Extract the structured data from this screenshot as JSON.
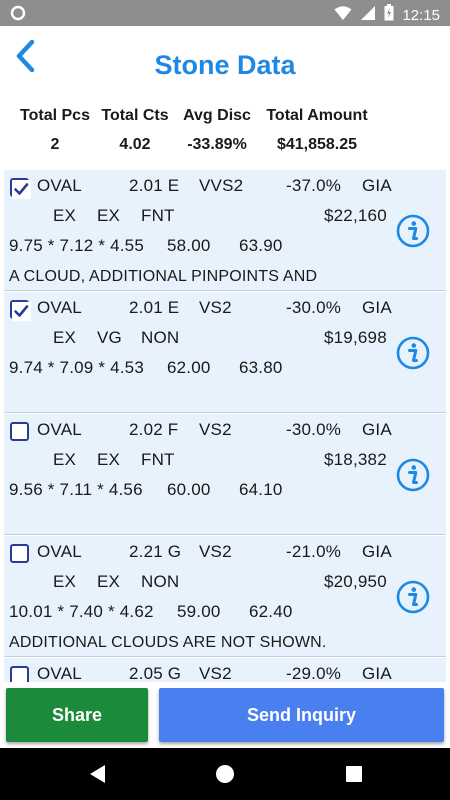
{
  "status": {
    "time": "12:15",
    "icons": [
      "notification-icon",
      "wifi-icon",
      "signal-icon",
      "battery-icon"
    ]
  },
  "header": {
    "title": "Stone Data",
    "back_icon": "back-chevron-icon"
  },
  "summary": {
    "labels": [
      "Total Pcs",
      "Total Cts",
      "Avg Disc",
      "Total Amount"
    ],
    "values": [
      "2",
      "4.02",
      "-33.89%",
      "$41,858.25"
    ]
  },
  "stones": [
    {
      "checked": true,
      "shape": "OVAL",
      "carat_color": "2.01 E",
      "clarity": "VVS2",
      "discount": "-37.0%",
      "lab": "GIA",
      "cut": "EX",
      "polish": "EX",
      "fluor": "FNT",
      "amount": "$22,160",
      "measurements": "9.75 * 7.12 * 4.55",
      "depth": "58.00",
      "table": "63.90",
      "comment": "A CLOUD, ADDITIONAL PINPOINTS AND"
    },
    {
      "checked": true,
      "shape": "OVAL",
      "carat_color": "2.01 E",
      "clarity": "VS2",
      "discount": "-30.0%",
      "lab": "GIA",
      "cut": "EX",
      "polish": "VG",
      "fluor": "NON",
      "amount": "$19,698",
      "measurements": "9.74 * 7.09 * 4.53",
      "depth": "62.00",
      "table": "63.80",
      "comment": ""
    },
    {
      "checked": false,
      "shape": "OVAL",
      "carat_color": "2.02 F",
      "clarity": "VS2",
      "discount": "-30.0%",
      "lab": "GIA",
      "cut": "EX",
      "polish": "EX",
      "fluor": "FNT",
      "amount": "$18,382",
      "measurements": "9.56 * 7.11 * 4.56",
      "depth": "60.00",
      "table": "64.10",
      "comment": ""
    },
    {
      "checked": false,
      "shape": "OVAL",
      "carat_color": "2.21 G",
      "clarity": "VS2",
      "discount": "-21.0%",
      "lab": "GIA",
      "cut": "EX",
      "polish": "EX",
      "fluor": "NON",
      "amount": "$20,950",
      "measurements": "10.01 * 7.40 * 4.62",
      "depth": "59.00",
      "table": "62.40",
      "comment": "ADDITIONAL CLOUDS ARE NOT SHOWN."
    },
    {
      "checked": false,
      "shape": "OVAL",
      "carat_color": "2.05 G",
      "clarity": "VS2",
      "discount": "-29.0%",
      "lab": "GIA",
      "cut": "",
      "polish": "",
      "fluor": "",
      "amount": "",
      "measurements": "",
      "depth": "",
      "table": "",
      "comment": ""
    }
  ],
  "actions": {
    "share_label": "Share",
    "inquiry_label": "Send Inquiry"
  },
  "colors": {
    "accent": "#1e88e5",
    "card_bg": "#e8f2fc",
    "share_bg": "#1b8a3b",
    "inquiry_bg": "#4a7ff0",
    "status_bar": "#8e8e8e"
  }
}
